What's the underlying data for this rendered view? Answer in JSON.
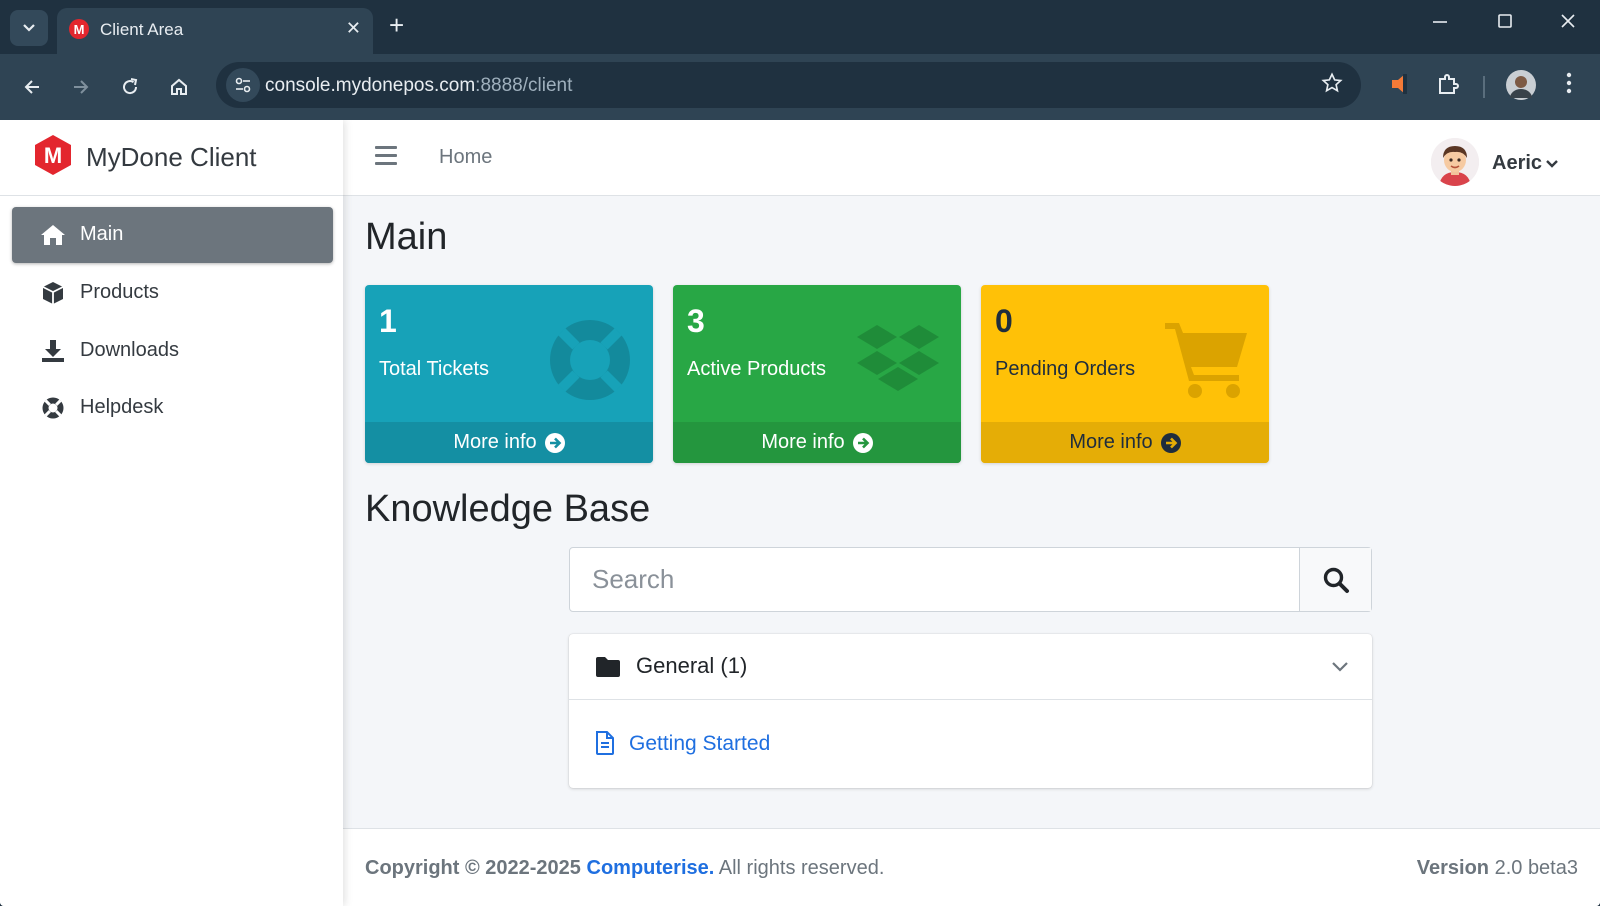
{
  "browser": {
    "tab_title": "Client Area",
    "favicon_letter": "M",
    "url_host": "console.mydonepos.com",
    "url_path": ":8888/client"
  },
  "sidebar": {
    "brand": "MyDone Client",
    "brand_letter": "M",
    "items": [
      {
        "label": "Main",
        "icon": "home-icon",
        "active": true
      },
      {
        "label": "Products",
        "icon": "box-icon",
        "active": false
      },
      {
        "label": "Downloads",
        "icon": "download-icon",
        "active": false
      },
      {
        "label": "Helpdesk",
        "icon": "lifebuoy-icon",
        "active": false
      }
    ]
  },
  "topbar": {
    "home_link": "Home",
    "user_name": "Aeric"
  },
  "main": {
    "title": "Main",
    "boxes": [
      {
        "value": "1",
        "label": "Total Tickets",
        "footer": "More info",
        "icon": "lifebuoy-icon",
        "color": "#17a2b8"
      },
      {
        "value": "3",
        "label": "Active Products",
        "footer": "More info",
        "icon": "dropbox-icon",
        "color": "#28a745"
      },
      {
        "value": "0",
        "label": "Pending Orders",
        "footer": "More info",
        "icon": "cart-icon",
        "color": "#ffc107"
      }
    ]
  },
  "kb": {
    "title": "Knowledge Base",
    "search_placeholder": "Search",
    "category": "General (1)",
    "article": "Getting Started"
  },
  "footer": {
    "copyright_prefix": "Copyright © 2022-2025",
    "company": "Computerise.",
    "rights": "All rights reserved.",
    "version_label": "Version",
    "version_value": "2.0 beta3"
  }
}
